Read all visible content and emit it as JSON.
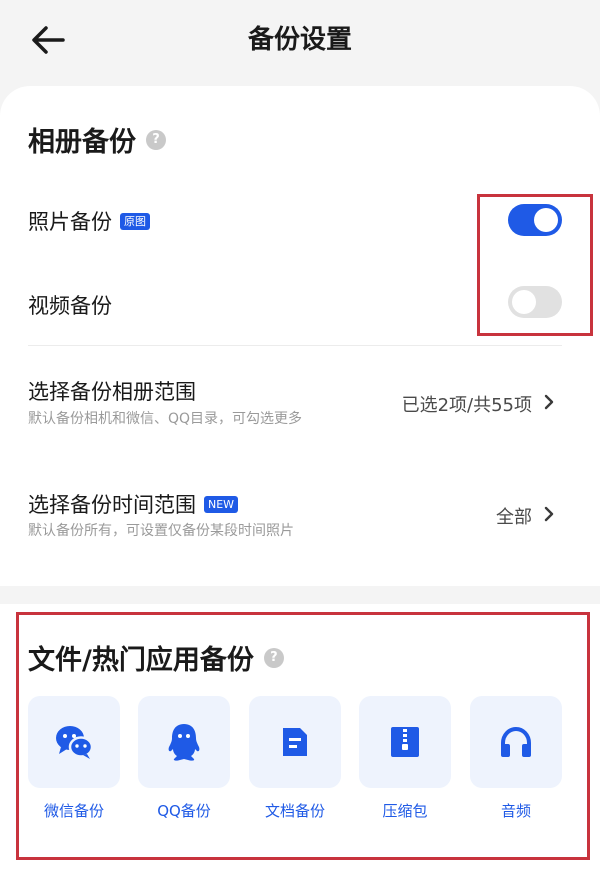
{
  "header": {
    "title": "备份设置"
  },
  "album_section": {
    "title": "相册备份",
    "help": "?",
    "photo_backup": {
      "label": "照片备份",
      "badge": "原图",
      "enabled": true
    },
    "video_backup": {
      "label": "视频备份",
      "enabled": false
    },
    "album_range": {
      "title": "选择备份相册范围",
      "subtitle": "默认备份相机和微信、QQ目录，可勾选更多",
      "value": "已选2项/共55项"
    },
    "time_range": {
      "title": "选择备份时间范围",
      "badge": "NEW",
      "subtitle": "默认备份所有，可设置仅备份某段时间照片",
      "value": "全部"
    }
  },
  "file_section": {
    "title": "文件/热门应用备份",
    "help": "?",
    "apps": [
      {
        "label": "微信备份",
        "icon": "wechat-icon"
      },
      {
        "label": "QQ备份",
        "icon": "qq-icon"
      },
      {
        "label": "文档备份",
        "icon": "document-icon"
      },
      {
        "label": "压缩包",
        "icon": "zip-icon"
      },
      {
        "label": "音频",
        "icon": "headphones-icon"
      }
    ]
  },
  "colors": {
    "accent": "#1f5ae6",
    "highlight_box": "#c8333d",
    "toggle_off": "#e1e1e1",
    "tile_bg": "#eef3fd"
  }
}
